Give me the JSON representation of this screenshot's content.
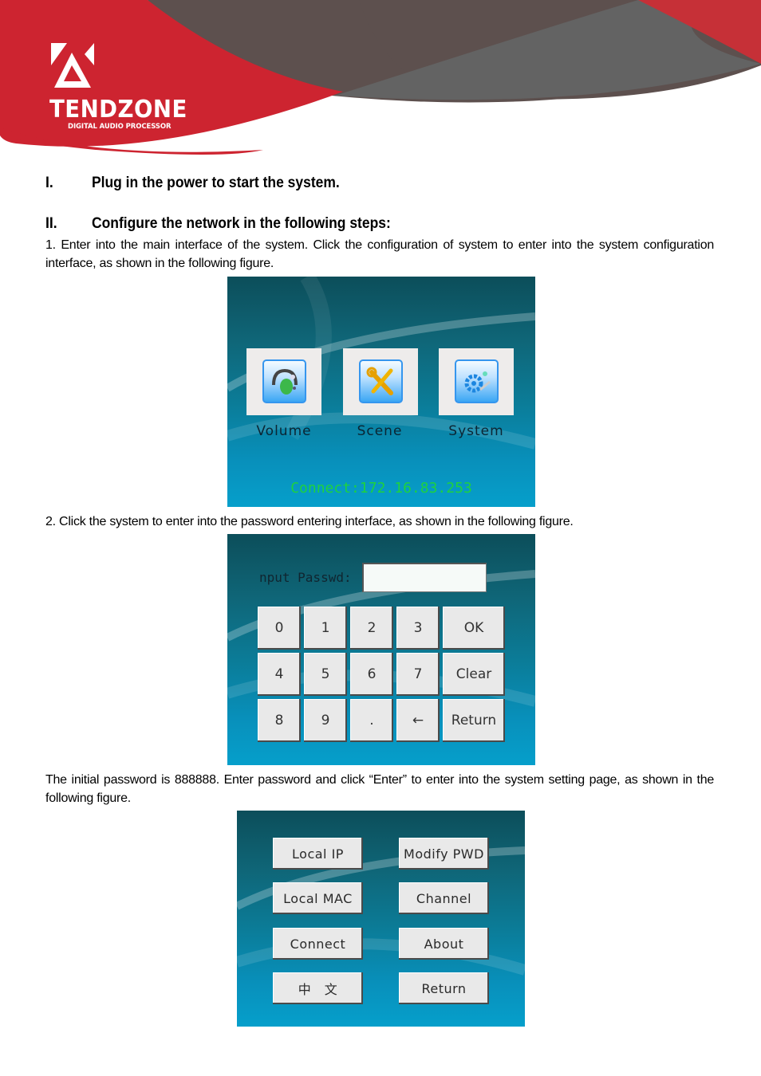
{
  "brand": {
    "name": "TENDZONE",
    "tagline": "DIGITAL AUDIO PROCESSOR",
    "colors": {
      "red": "#cd2430",
      "dark_gray": "#5d504e",
      "gray": "#626262"
    }
  },
  "sections": [
    {
      "num": "I.",
      "title": "Plug in the power to start the system."
    },
    {
      "num": "II.",
      "title": "Configure the network in the following steps:"
    }
  ],
  "paragraphs": {
    "step1": "1. Enter into the main interface of the system. Click the configuration of system to enter into the system configuration interface, as shown in the following figure.",
    "step2": "2. Click the system to enter into the password entering interface, as shown in the following figure.",
    "step3": "The initial password is 888888. Enter password and click “Enter” to enter into the system setting page, as shown in the following figure."
  },
  "figure1": {
    "tiles": [
      {
        "label": "Volume",
        "icon": "headphones-icon"
      },
      {
        "label": "Scene",
        "icon": "tools-icon"
      },
      {
        "label": "System",
        "icon": "gear-icon"
      }
    ],
    "connect_text": "Connect:172.16.83.253",
    "connect_color": "#1ed23e"
  },
  "figure2": {
    "label": "nput Passwd:",
    "input_value": "",
    "keys": [
      "0",
      "1",
      "2",
      "3",
      "OK",
      "4",
      "5",
      "6",
      "7",
      "Clear",
      "8",
      "9",
      ".",
      "←",
      "Return"
    ]
  },
  "figure3": {
    "buttons_left": [
      "Local IP",
      "Local MAC",
      "Connect",
      "中　文"
    ],
    "buttons_right": [
      "Modify PWD",
      "Channel",
      "About",
      "Return"
    ]
  }
}
